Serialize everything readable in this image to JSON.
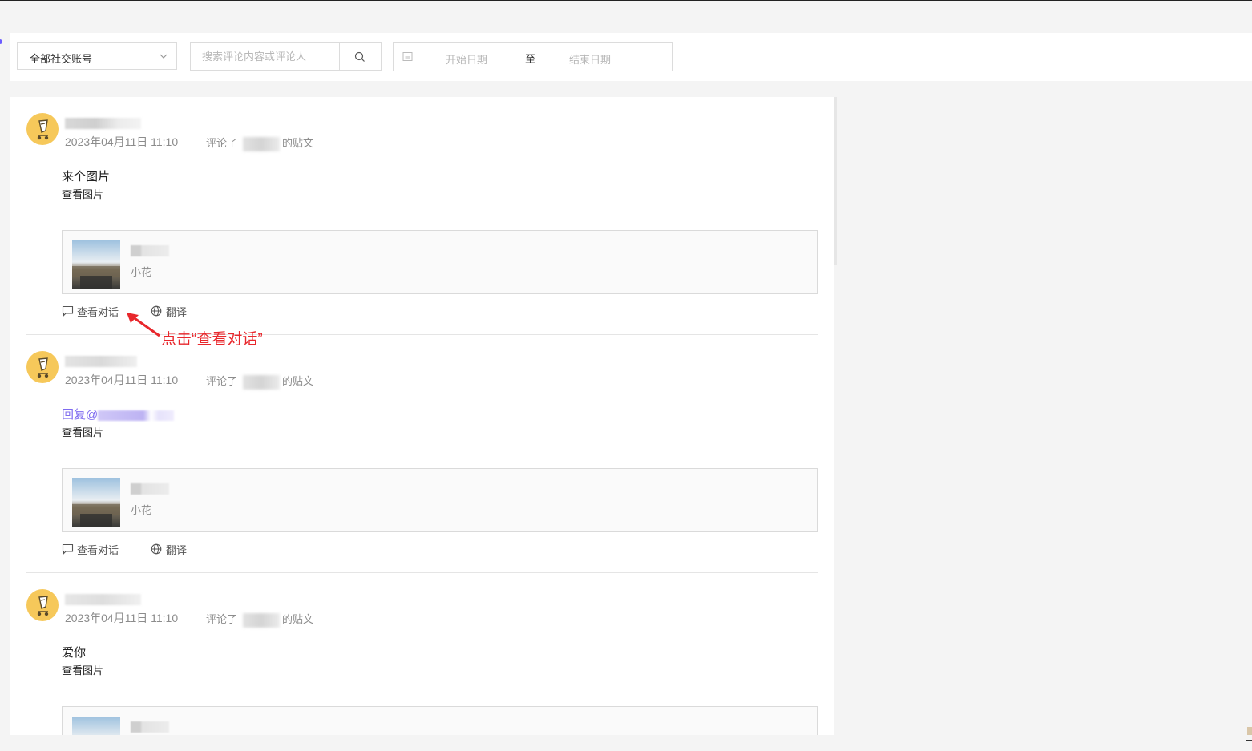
{
  "filter": {
    "account_select": "全部社交账号",
    "search_placeholder": "搜索评论内容或评论人",
    "date_start_placeholder": "开始日期",
    "date_separator": "至",
    "date_end_placeholder": "结束日期"
  },
  "comments": [
    {
      "time": "2023年04月11日 11:10",
      "commented": "评论了",
      "post_suffix": "的贴文",
      "content": "来个图片",
      "view_image": "查看图片",
      "post_author": "小花",
      "view_dialog": "查看对话",
      "translate": "翻译"
    },
    {
      "time": "2023年04月11日 11:10",
      "commented": "评论了",
      "post_suffix": "的贴文",
      "reply_prefix": "回复@",
      "view_image": "查看图片",
      "post_author": "小花",
      "view_dialog": "查看对话",
      "translate": "翻译"
    },
    {
      "time": "2023年04月11日 11:10",
      "commented": "评论了",
      "post_suffix": "的贴文",
      "content": "爱你",
      "view_image": "查看图片"
    }
  ],
  "annotation": {
    "text": "点击“查看对话”",
    "color": "#e8272c"
  },
  "colors": {
    "reply_link": "#7f6cf0",
    "avatar_bg": "#f6c85a"
  }
}
